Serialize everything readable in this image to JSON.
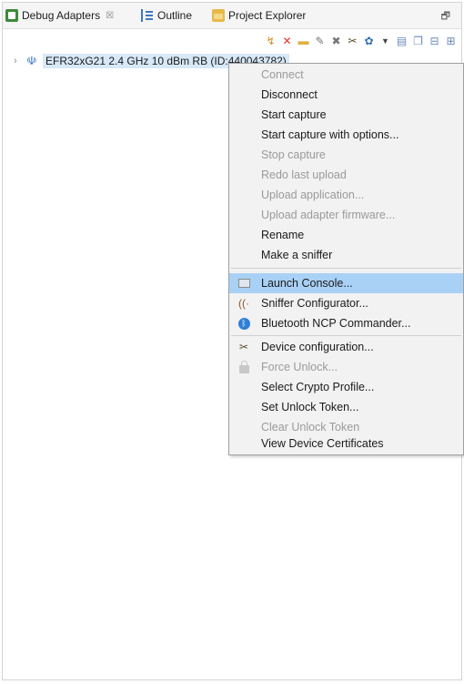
{
  "tabs": [
    {
      "label": "Debug Adapters",
      "close": "☒"
    },
    {
      "label": "Outline"
    },
    {
      "label": "Project Explorer"
    }
  ],
  "window_controls": {
    "restore": "🗗"
  },
  "toolbar_icons": [
    "refresh-icon",
    "tools-icon",
    "folder-icon",
    "edit-icon",
    "delete-icon",
    "config-icon",
    "gear-icon",
    "dropdown-icon",
    "list-icon",
    "copy-icon",
    "collapse-icon",
    "expand-icon"
  ],
  "tree": {
    "items": [
      {
        "label": "EFR32xG21 2.4 GHz 10 dBm RB (ID:440043782)",
        "expanded": false
      }
    ]
  },
  "context_menu": {
    "items": [
      {
        "label": "Connect",
        "enabled": false
      },
      {
        "label": "Disconnect",
        "enabled": true
      },
      {
        "label": "Start capture",
        "enabled": true
      },
      {
        "label": "Start capture with options...",
        "enabled": true
      },
      {
        "label": "Stop capture",
        "enabled": false
      },
      {
        "label": "Redo last upload",
        "enabled": false
      },
      {
        "label": "Upload application...",
        "enabled": false
      },
      {
        "label": "Upload adapter firmware...",
        "enabled": false
      },
      {
        "label": "Rename",
        "enabled": true
      },
      {
        "label": "Make a sniffer",
        "enabled": true
      },
      {
        "label": "Launch Console...",
        "enabled": true,
        "highlighted": true
      },
      {
        "label": "Sniffer Configurator...",
        "enabled": true
      },
      {
        "label": "Bluetooth NCP Commander...",
        "enabled": true
      },
      {
        "label": "Device configuration...",
        "enabled": true
      },
      {
        "label": "Force Unlock...",
        "enabled": false
      },
      {
        "label": "Select Crypto Profile...",
        "enabled": true
      },
      {
        "label": "Set Unlock Token...",
        "enabled": true
      },
      {
        "label": "Clear Unlock Token",
        "enabled": false
      },
      {
        "label": "View Device Certificates",
        "enabled": true
      }
    ]
  },
  "colors": {
    "selection": "#d7e8f8",
    "menu_highlight": "#a9d1f5",
    "disabled_text": "#9a9a9a",
    "menu_bg": "#f2f2f2"
  }
}
